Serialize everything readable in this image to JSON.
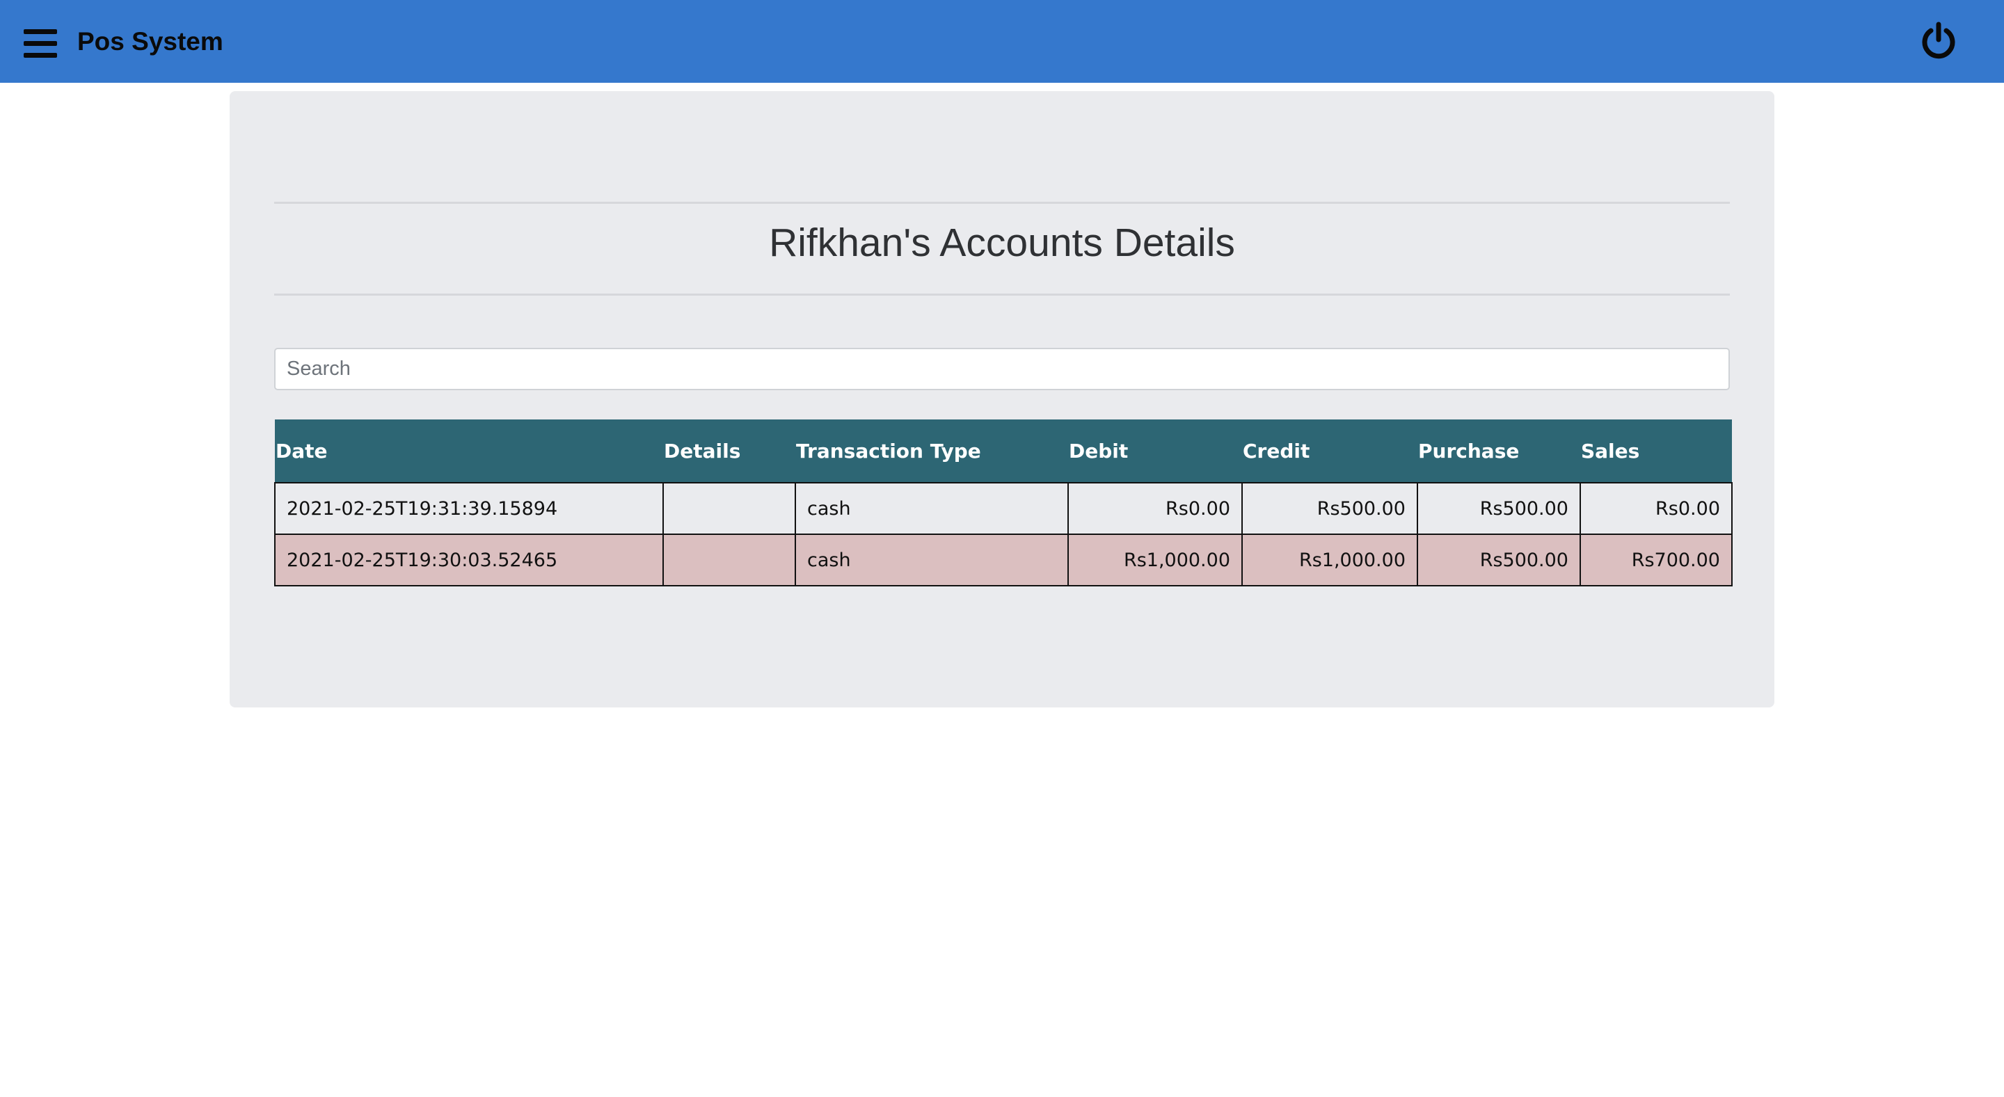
{
  "app": {
    "title": "Pos System"
  },
  "page": {
    "title": "Rifkhan's Accounts Details"
  },
  "search": {
    "placeholder": "Search",
    "value": ""
  },
  "table": {
    "headers": {
      "date": "Date",
      "details": "Details",
      "transaction_type": "Transaction Type",
      "debit": "Debit",
      "credit": "Credit",
      "purchase": "Purchase",
      "sales": "Sales"
    },
    "rows": [
      {
        "date": "2021-02-25T19:31:39.15894",
        "details": "",
        "transaction_type": "cash",
        "debit": "Rs0.00",
        "credit": "Rs500.00",
        "purchase": "Rs500.00",
        "sales": "Rs0.00"
      },
      {
        "date": "2021-02-25T19:30:03.52465",
        "details": "",
        "transaction_type": "cash",
        "debit": "Rs1,000.00",
        "credit": "Rs1,000.00",
        "purchase": "Rs500.00",
        "sales": "Rs700.00"
      }
    ]
  },
  "icons": {
    "menu": "hamburger-menu-icon",
    "power": "power-icon"
  },
  "colors": {
    "navbar": "#3578cd",
    "table_header": "#2d6674",
    "row_highlight": "#dbbfc0",
    "card_background": "#eaebee"
  }
}
